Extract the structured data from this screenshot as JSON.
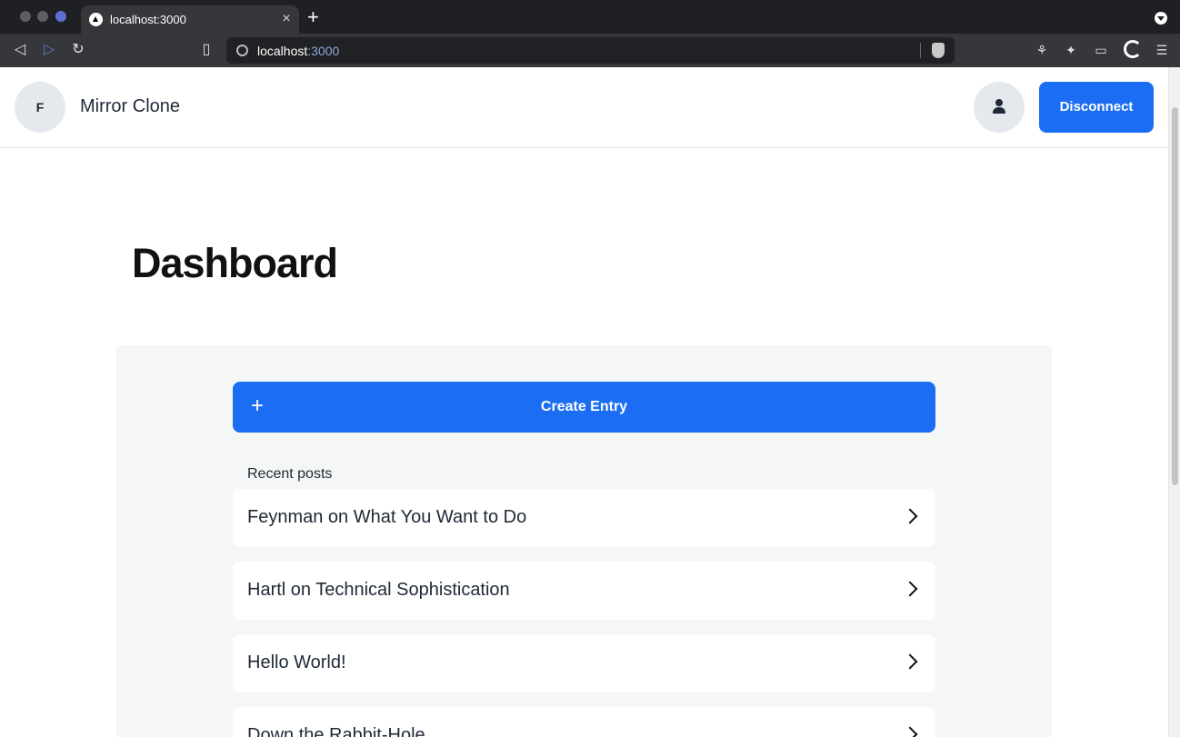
{
  "browser": {
    "tab_title": "localhost:3000",
    "url_host": "localhost",
    "url_port": ":3000",
    "tab_close": "×",
    "new_tab": "+"
  },
  "header": {
    "logo_initial": "F",
    "site_title": "Mirror Clone",
    "disconnect_label": "Disconnect"
  },
  "main": {
    "title": "Dashboard",
    "create_label": "Create Entry",
    "create_icon": "+",
    "recent_label": "Recent posts",
    "posts": [
      {
        "title": "Feynman on What You Want to Do"
      },
      {
        "title": "Hartl on Technical Sophistication"
      },
      {
        "title": "Hello World!"
      },
      {
        "title": "Down the Rabbit-Hole"
      }
    ]
  },
  "colors": {
    "accent": "#1b6ef3",
    "panel_bg": "#f5f6f6",
    "avatar_bg": "#e5e9ee"
  }
}
